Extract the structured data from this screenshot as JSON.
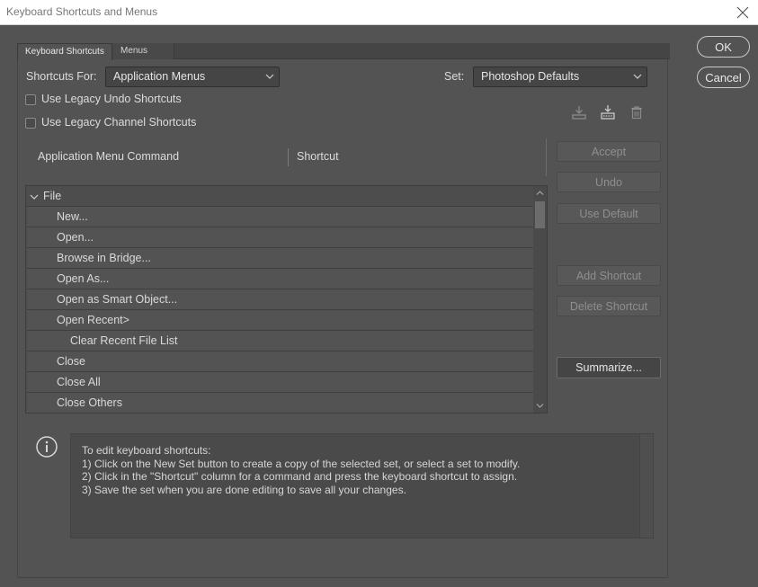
{
  "window": {
    "title": "Keyboard Shortcuts and Menus"
  },
  "tabs": [
    {
      "label": "Keyboard Shortcuts",
      "active": true
    },
    {
      "label": "Menus",
      "active": false
    }
  ],
  "shortcuts_for": {
    "label": "Shortcuts For:",
    "value": "Application Menus"
  },
  "set": {
    "label": "Set:",
    "value": "Photoshop Defaults"
  },
  "options": [
    {
      "label": "Use Legacy Undo Shortcuts",
      "checked": false
    },
    {
      "label": "Use Legacy Channel Shortcuts",
      "checked": false
    }
  ],
  "set_icons": [
    "save-set-icon",
    "new-set-icon",
    "delete-set-icon"
  ],
  "table": {
    "col1": "Application Menu Command",
    "col2": "Shortcut",
    "rows": [
      {
        "label": "File",
        "type": "group",
        "expanded": true
      },
      {
        "label": "New...",
        "type": "item",
        "indent": 1
      },
      {
        "label": "Open...",
        "type": "item",
        "indent": 1
      },
      {
        "label": "Browse in Bridge...",
        "type": "item",
        "indent": 1
      },
      {
        "label": "Open As...",
        "type": "item",
        "indent": 1
      },
      {
        "label": "Open as Smart Object...",
        "type": "item",
        "indent": 1
      },
      {
        "label": "Open Recent>",
        "type": "item",
        "indent": 1
      },
      {
        "label": "Clear Recent File List",
        "type": "item",
        "indent": 2
      },
      {
        "label": "Close",
        "type": "item",
        "indent": 1
      },
      {
        "label": "Close All",
        "type": "item",
        "indent": 1
      },
      {
        "label": "Close Others",
        "type": "item",
        "indent": 1
      }
    ]
  },
  "side_buttons": {
    "accept": "Accept",
    "undo": "Undo",
    "use_default": "Use Default",
    "add_shortcut": "Add Shortcut",
    "delete_shortcut": "Delete Shortcut",
    "summarize": "Summarize..."
  },
  "dialog_buttons": {
    "ok": "OK",
    "cancel": "Cancel"
  },
  "info": {
    "text": "To edit keyboard shortcuts:\n1) Click on the New Set button to create a copy of the selected set, or select a set to modify.\n2) Click in the \"Shortcut\" column for a command and press the keyboard shortcut to assign.\n3) Save the set when you are done editing to save all your changes."
  },
  "colors": {
    "background": "#535353",
    "panel": "#4a4a4a",
    "text": "#dcdcdc",
    "disabled_text": "#8f8f8f"
  }
}
